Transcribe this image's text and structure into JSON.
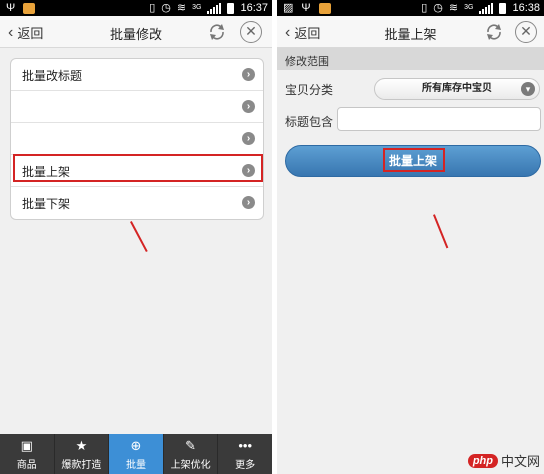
{
  "left": {
    "status": {
      "time": "16:37",
      "network": "3G"
    },
    "nav": {
      "back_label": "返回",
      "title": "批量修改"
    },
    "menu_items": [
      {
        "label": "批量改标题"
      },
      {
        "label": ""
      },
      {
        "label": ""
      },
      {
        "label": "批量上架"
      },
      {
        "label": "批量下架"
      }
    ],
    "tabs": [
      {
        "label": "商品",
        "icon": "briefcase-icon"
      },
      {
        "label": "爆款打造",
        "icon": "star-page-icon"
      },
      {
        "label": "批量",
        "icon": "plus-circle-icon"
      },
      {
        "label": "上架优化",
        "icon": "edit-page-icon"
      },
      {
        "label": "更多",
        "icon": "more-dots-icon"
      }
    ],
    "active_tab": "批量"
  },
  "right": {
    "status": {
      "time": "16:38",
      "network": "3G"
    },
    "nav": {
      "back_label": "返回",
      "title": "批量上架"
    },
    "section_title": "修改范围",
    "category": {
      "label": "宝贝分类",
      "selected": "所有库存中宝贝"
    },
    "title_filter": {
      "label": "标题包含",
      "value": "",
      "placeholder": ""
    },
    "action_button": {
      "label": "批量上架"
    }
  },
  "watermark": {
    "logo": "php",
    "text": "中文网"
  },
  "colors": {
    "highlight": "#d42424",
    "active_tab": "#3d8fd6",
    "button": "#4a8bc4"
  }
}
